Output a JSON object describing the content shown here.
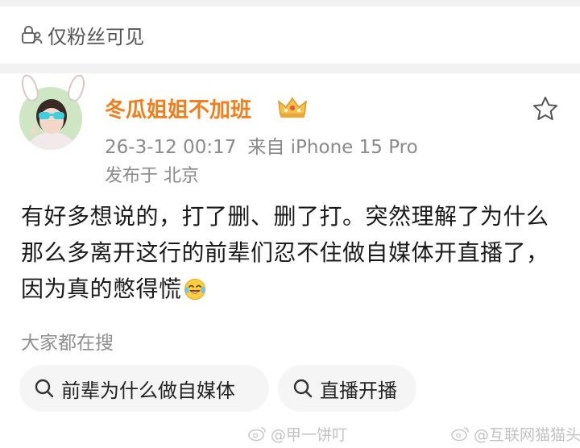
{
  "visibility": {
    "label": "仅粉丝可见"
  },
  "post": {
    "author": "冬瓜姐姐不加班",
    "date": "26-3-12 00:17",
    "source": "来自 iPhone 15 Pro",
    "location": "发布于 北京",
    "text": "有好多想说的，打了删、删了打。突然理解了为什么那么多离开这行的前辈们忍不住做自媒体开直播了，因为真的憋得慌"
  },
  "search": {
    "label": "大家都在搜",
    "chips": [
      "前辈为什么做自媒体",
      "直播开播"
    ]
  },
  "watermarks": [
    "@甲一饼叮",
    "@互联网猫猫头"
  ],
  "icons": {
    "visibility": "lock-person-icon",
    "badge": "crown-badge-icon",
    "favorite": "star-outline-icon",
    "emoji": "laughing-tears-emoji",
    "search": "search-icon",
    "watermark": "weibo-logo-icon"
  },
  "colors": {
    "username": "#f27d1b",
    "meta": "#8a8a8a",
    "chip_bg": "#f5f5f5"
  }
}
